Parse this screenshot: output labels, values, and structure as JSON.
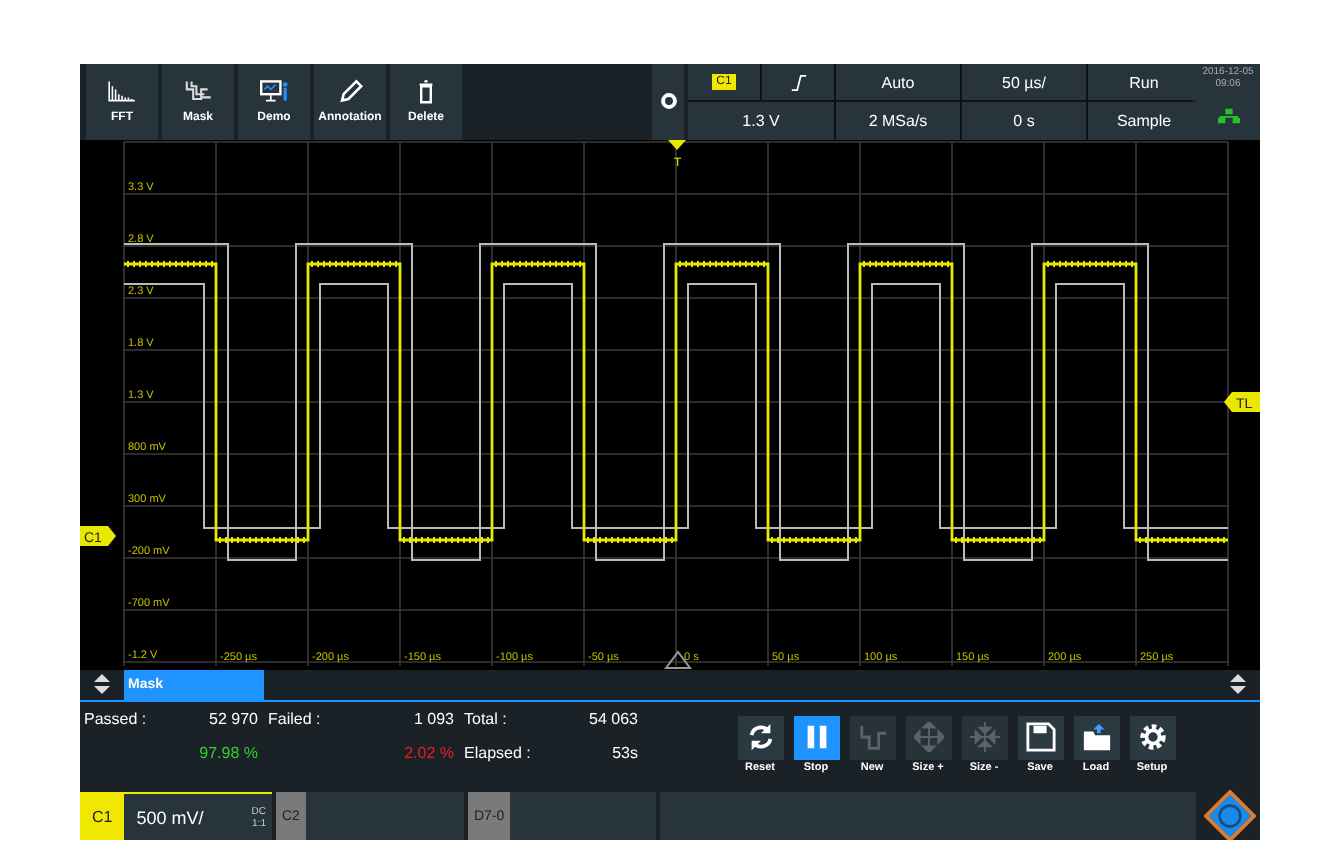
{
  "toolbar": {
    "buttons": [
      {
        "label": "FFT",
        "kind": "fft"
      },
      {
        "label": "Mask",
        "kind": "mask"
      },
      {
        "label": "Demo",
        "kind": "demo"
      },
      {
        "label": "Annotation",
        "kind": "annotation"
      },
      {
        "label": "Delete",
        "kind": "delete"
      }
    ]
  },
  "settings": {
    "channel": "C1",
    "trigger_mode": "Auto",
    "time_scale": "50 µs/",
    "run_state": "Run",
    "trigger_level": "1.3 V",
    "sample_rate": "2 MSa/s",
    "position": "0 s",
    "acquisition": "Sample"
  },
  "datetime": {
    "date": "2016-12-05",
    "time": "09:06"
  },
  "plot": {
    "y_labels": [
      "3.3 V",
      "2.8 V",
      "2.3 V",
      "1.8 V",
      "1.3 V",
      "800 mV",
      "300 mV",
      "-200 mV",
      "-700 mV",
      "-1.2 V"
    ],
    "x_labels": [
      "-250 µs",
      "-200 µs",
      "-150 µs",
      "-100 µs",
      "-50 µs",
      "0 s",
      "50 µs",
      "100 µs",
      "150 µs",
      "200 µs",
      "250 µs"
    ],
    "channel_marker": "C1",
    "trigger_marker": "TL",
    "time_marker": "T"
  },
  "tabs": [
    {
      "label": "Mask",
      "selected": true
    }
  ],
  "stats": {
    "passed": {
      "label": "Passed :",
      "value": "52 970",
      "percent": "97.98 %"
    },
    "failed": {
      "label": "Failed :",
      "value": "1 093",
      "percent": "2.02 %"
    },
    "total": {
      "label": "Total :",
      "value": "54 063"
    },
    "elapsed": {
      "label": "Elapsed :",
      "value": "53s"
    }
  },
  "actions": [
    {
      "label": "Reset",
      "kind": "reset",
      "selected": false,
      "disabled": false
    },
    {
      "label": "Stop",
      "kind": "pause",
      "selected": true,
      "disabled": false
    },
    {
      "label": "New",
      "kind": "new",
      "selected": false,
      "disabled": true
    },
    {
      "label": "Size +",
      "kind": "grow",
      "selected": false,
      "disabled": true
    },
    {
      "label": "Size -",
      "kind": "shrink",
      "selected": false,
      "disabled": true
    },
    {
      "label": "Save",
      "kind": "save",
      "selected": false,
      "disabled": false
    },
    {
      "label": "Load",
      "kind": "load",
      "selected": false,
      "disabled": false
    },
    {
      "label": "Setup",
      "kind": "setup",
      "selected": false,
      "disabled": false
    }
  ],
  "channels": [
    {
      "label": "C1",
      "scale": "500 mV/",
      "coupling": "DC",
      "ratio": "1:1",
      "active": true
    },
    {
      "label": "C2",
      "active": false
    },
    {
      "label": "D7-0",
      "active": false
    }
  ]
}
